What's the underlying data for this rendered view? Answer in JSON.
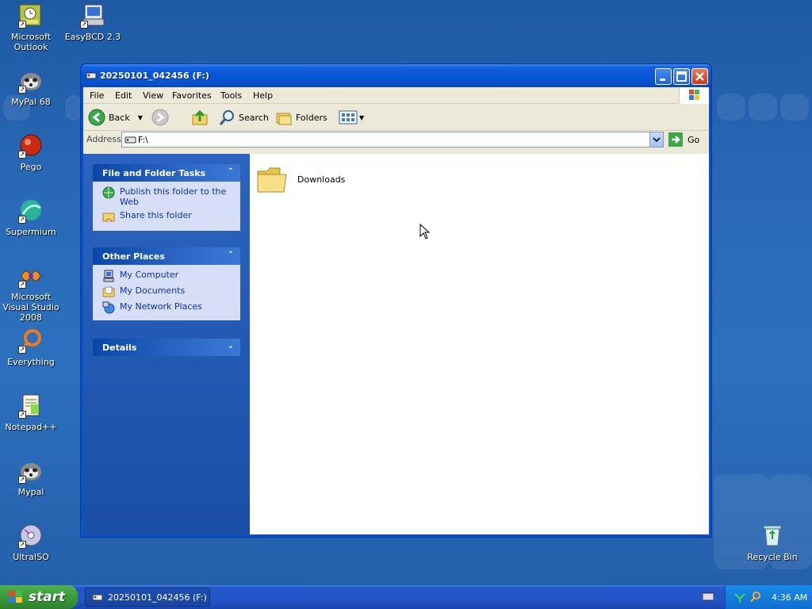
{
  "desktop": {
    "icons": [
      {
        "label": "Microsoft Outlook",
        "icon": "outlook-icon"
      },
      {
        "label": "EasyBCD 2.3",
        "icon": "easybcd-icon"
      },
      {
        "label": "MyPal 68",
        "icon": "mypal-icon"
      },
      {
        "label": "Pego",
        "icon": "pego-icon"
      },
      {
        "label": "Supermium",
        "icon": "supermium-icon"
      },
      {
        "label": "Microsoft Visual Studio 2008",
        "icon": "visual-studio-icon"
      },
      {
        "label": "Everything",
        "icon": "everything-icon"
      },
      {
        "label": "Notepad++",
        "icon": "notepadpp-icon"
      },
      {
        "label": "Mypal",
        "icon": "mypal-icon"
      },
      {
        "label": "UltraISO",
        "icon": "ultraiso-icon"
      },
      {
        "label": "Recycle Bin",
        "icon": "recycle-bin-icon"
      }
    ]
  },
  "window": {
    "title": "20250101_042456 (F:)",
    "menu": [
      "File",
      "Edit",
      "View",
      "Favorites",
      "Tools",
      "Help"
    ],
    "toolbar": {
      "back": "Back",
      "search": "Search",
      "folders": "Folders"
    },
    "address": {
      "label": "Address",
      "value": "F:\\",
      "go": "Go"
    },
    "tasks_panel": {
      "title": "File and Folder Tasks",
      "items": [
        "Publish this folder to the Web",
        "Share this folder"
      ]
    },
    "other_places": {
      "title": "Other Places",
      "items": [
        "My Computer",
        "My Documents",
        "My Network Places"
      ]
    },
    "details": {
      "title": "Details"
    },
    "files": [
      {
        "name": "Downloads",
        "icon": "folder-icon"
      }
    ]
  },
  "taskbar": {
    "start_label": "start",
    "task_button": "20250101_042456 (F:)",
    "clock": "4:36 AM"
  },
  "colors": {
    "accent": "#0a56d8",
    "taskpane": "#1a4fa5",
    "panel_body": "#d6dff7",
    "link": "#0c32a6"
  }
}
